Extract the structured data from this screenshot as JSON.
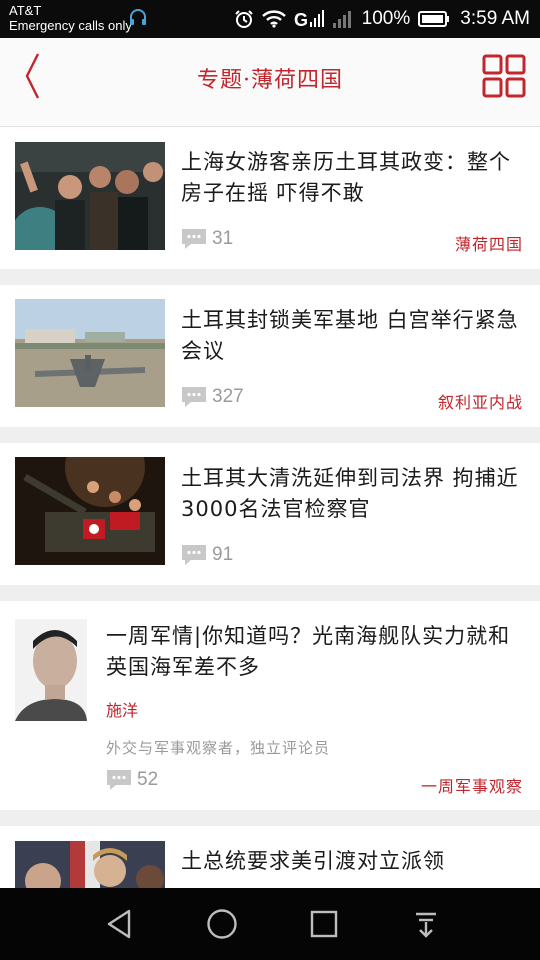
{
  "status_bar": {
    "carrier": "AT&T",
    "emergency": "Emergency calls only",
    "battery": "100%",
    "time": "3:59 AM"
  },
  "header": {
    "title": "专题·薄荷四国"
  },
  "articles": [
    {
      "title": "上海女游客亲历土耳其政变：整个房子在摇 吓得不敢",
      "comments": "31",
      "tag": "薄荷四国"
    },
    {
      "title": "土耳其封锁美军基地 白宫举行紧急会议",
      "comments": "327",
      "tag": "叙利亚内战"
    },
    {
      "title": "土耳其大清洗延伸到司法界 拘捕近3000名法官检察官",
      "comments": "91",
      "tag": ""
    },
    {
      "title": "一周军情|你知道吗？光南海舰队实力就和英国海军差不多",
      "author": "施洋",
      "author_desc": "外交与军事观察者，独立评论员",
      "comments": "52",
      "tag": "一周军事观察"
    },
    {
      "title": "土总统要求美引渡对立派领",
      "comments": "",
      "tag": ""
    }
  ],
  "colors": {
    "accent": "#c0262c",
    "meta_text": "#9a9a9a",
    "background": "#efefef"
  }
}
